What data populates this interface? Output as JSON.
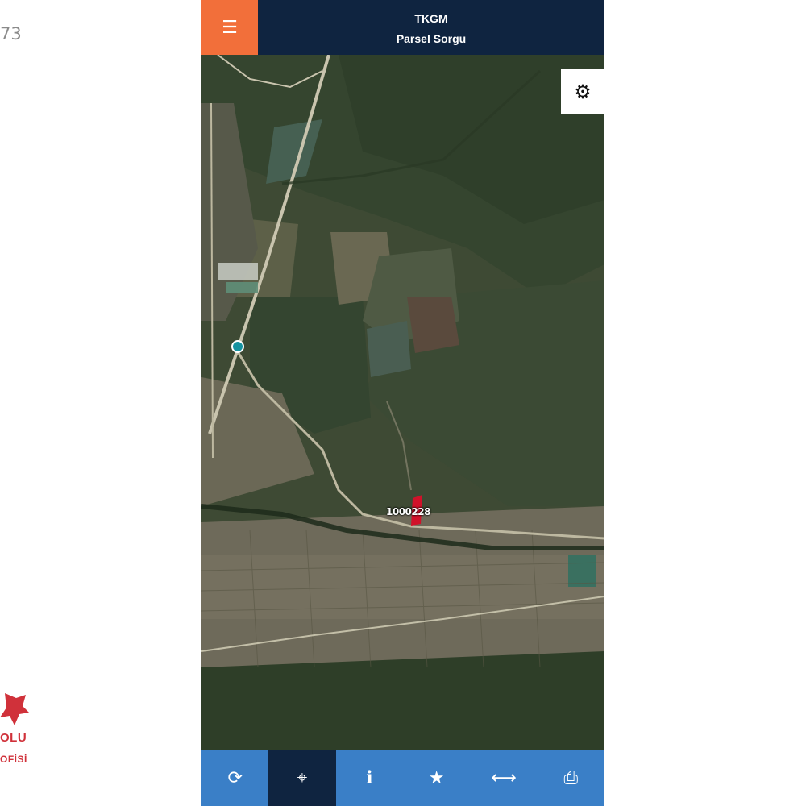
{
  "side": {
    "number_fragment": "73",
    "watermark": {
      "line1": "OLU",
      "line2": "OFİSİ"
    }
  },
  "header": {
    "title": "TKGM",
    "subtitle": "Parsel Sorgu",
    "menu_icon": "menu-icon"
  },
  "map": {
    "settings_icon": "gear-icon",
    "parcel_label": "1000228",
    "location_marker": "location-dot-icon"
  },
  "toolbar": {
    "items": [
      {
        "icon": "refresh-icon",
        "glyph": "⟳"
      },
      {
        "icon": "crosshair-icon",
        "glyph": "⌖"
      },
      {
        "icon": "info-icon",
        "glyph": "ℹ"
      },
      {
        "icon": "star-icon",
        "glyph": "★"
      },
      {
        "icon": "measure-icon",
        "glyph": "⟷"
      },
      {
        "icon": "print-icon",
        "glyph": "⎙"
      }
    ]
  },
  "colors": {
    "header_bg": "#0f2440",
    "menu_button": "#f26f3a",
    "toolbar_bg": "#3a7fc7",
    "toolbar_active": "#0f2440",
    "parcel": "#d0122a",
    "marker": "#1592a0"
  }
}
